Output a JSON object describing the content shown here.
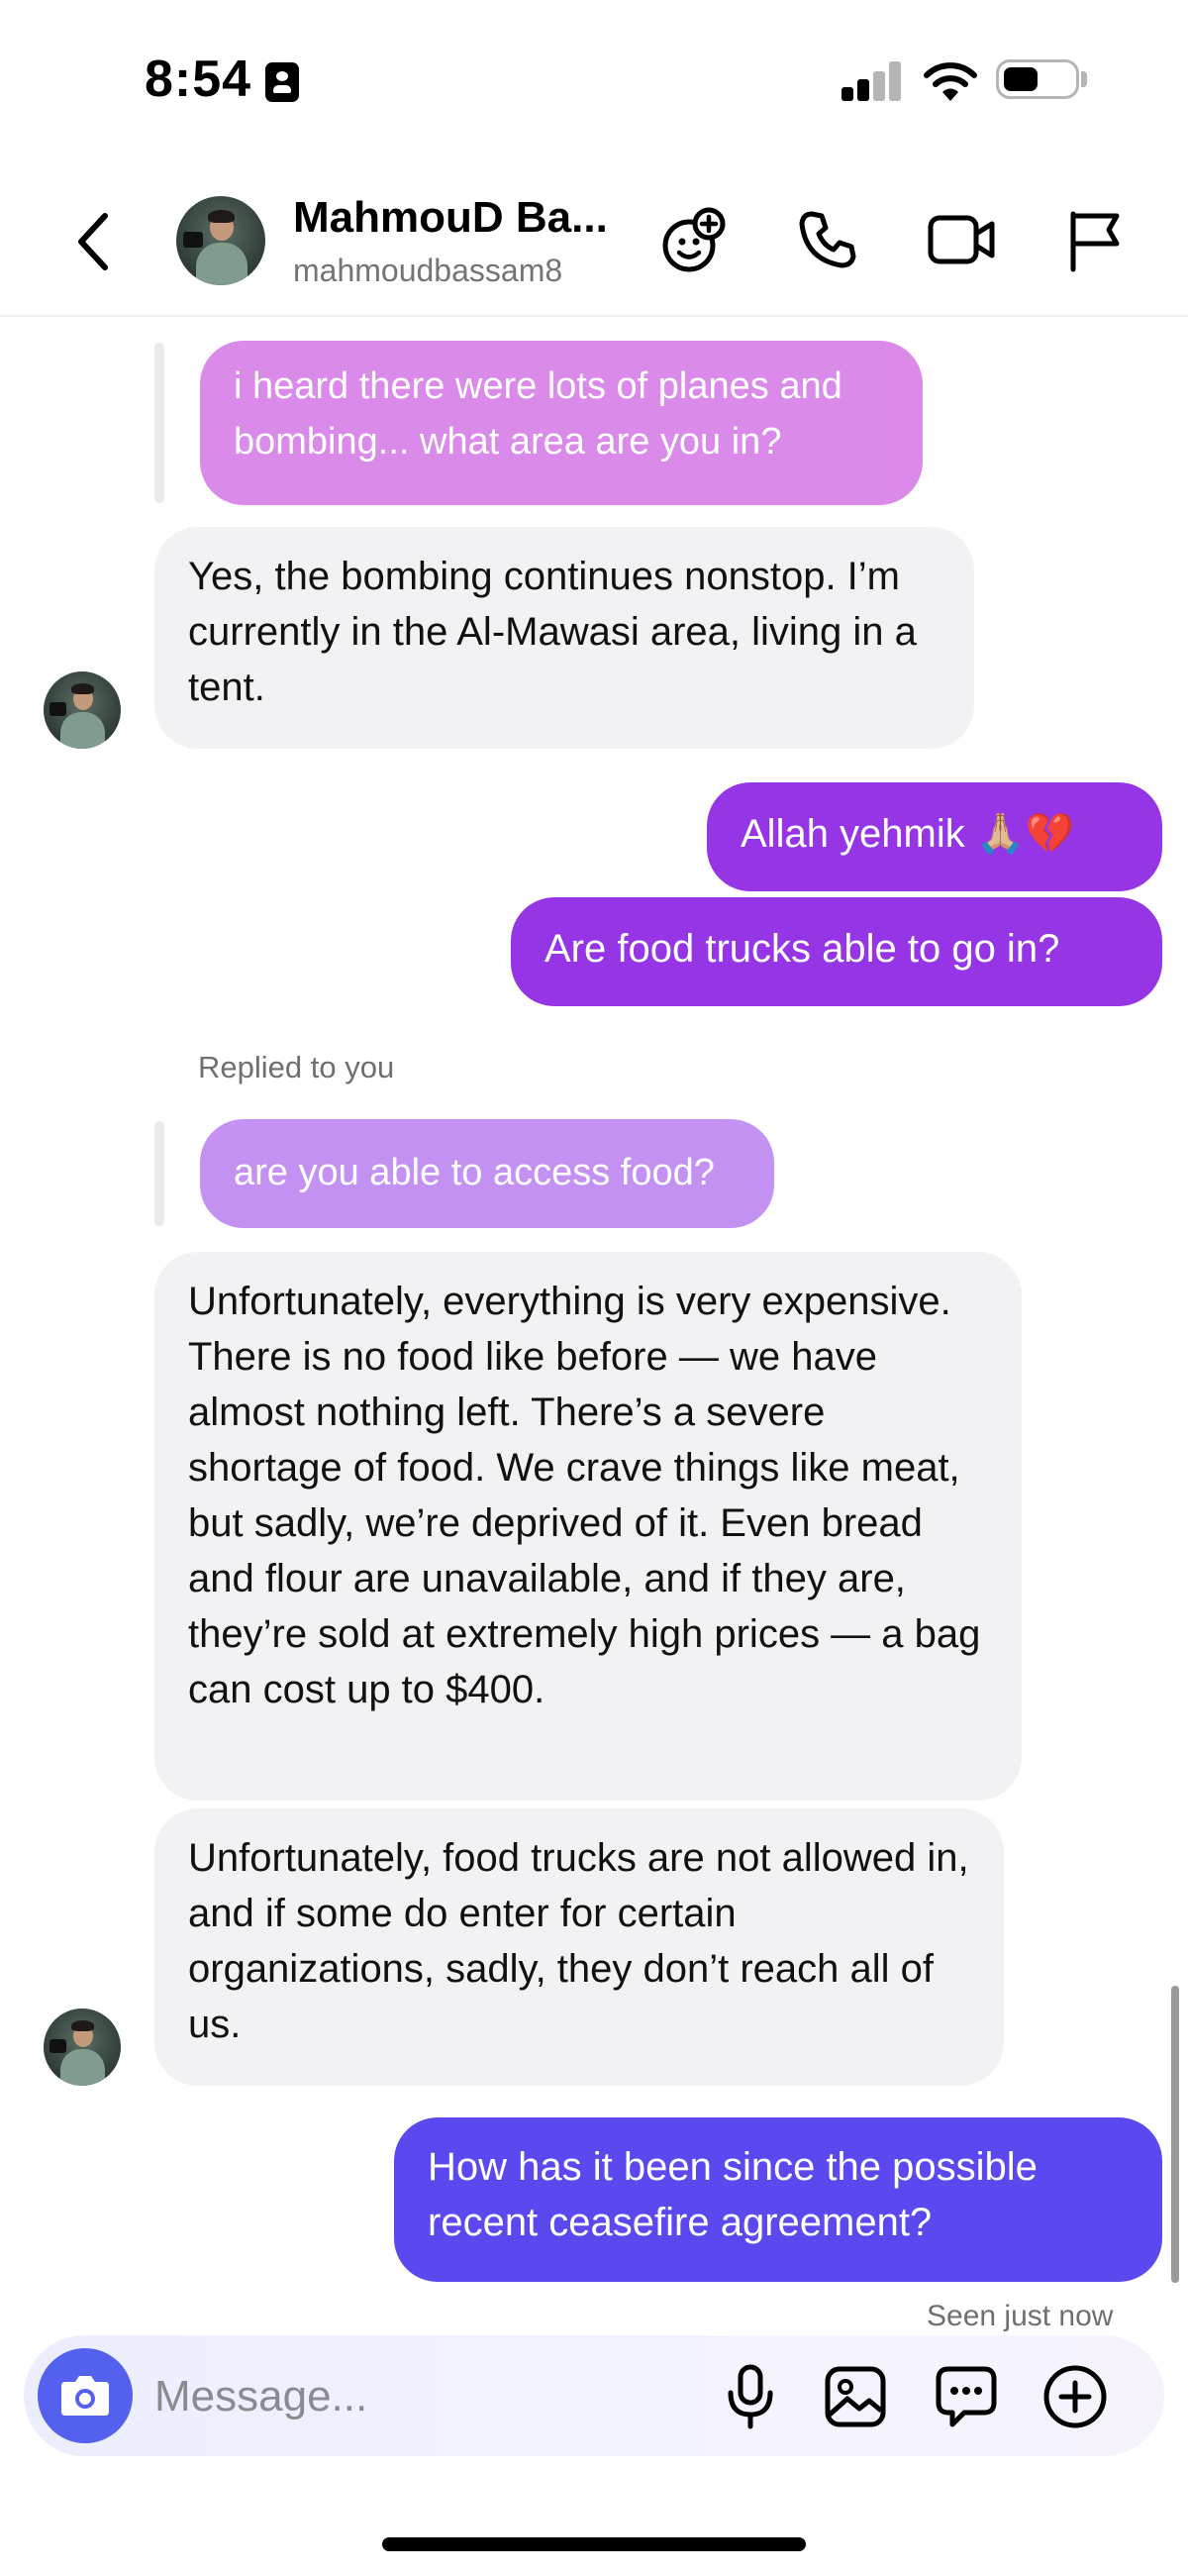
{
  "status_bar": {
    "time": "8:54"
  },
  "header": {
    "name": "MahmouD Ba...",
    "username": "mahmoudbassam8"
  },
  "messages": {
    "quote1": "i heard there were lots of planes and bombing... what area are you in?",
    "in1": "Yes, the bombing continues nonstop. I’m currently in the Al-Mawasi area, living in a tent.",
    "out1": "Allah yehmik 🙏🏼💔",
    "out2": "Are food trucks able to go in?",
    "replied_label": "Replied to you",
    "quote2": "are you able to access food?",
    "in2": "Unfortunately, everything is very expensive. There is no food like before — we have almost nothing left. There’s a severe shortage of food. We crave things like meat, but sadly, we’re deprived of it. Even bread and flour are unavailable, and if they are, they’re sold at extremely high prices — a bag can cost up to $400.",
    "in3": "Unfortunately, food trucks are not allowed in, and if some do enter for certain organizations, sadly, they don’t reach all of us.",
    "out3": "How has it been since the possible recent ceasefire agreement?",
    "seen": "Seen just now"
  },
  "composer": {
    "placeholder": "Message..."
  },
  "icons": {
    "header": [
      "back-icon",
      "emoji-plus-icon",
      "phone-icon",
      "video-icon",
      "flag-icon"
    ],
    "composer": [
      "camera-icon",
      "mic-icon",
      "gallery-icon",
      "chat-bubble-icon",
      "plus-circle-icon"
    ]
  },
  "colors": {
    "quote_bubble": "#d984e8",
    "outgoing_purple": "#9535e6",
    "outgoing_indigo": "#5b48ee",
    "incoming_bubble": "#f2f2f4",
    "camera_button": "#5460ee"
  }
}
